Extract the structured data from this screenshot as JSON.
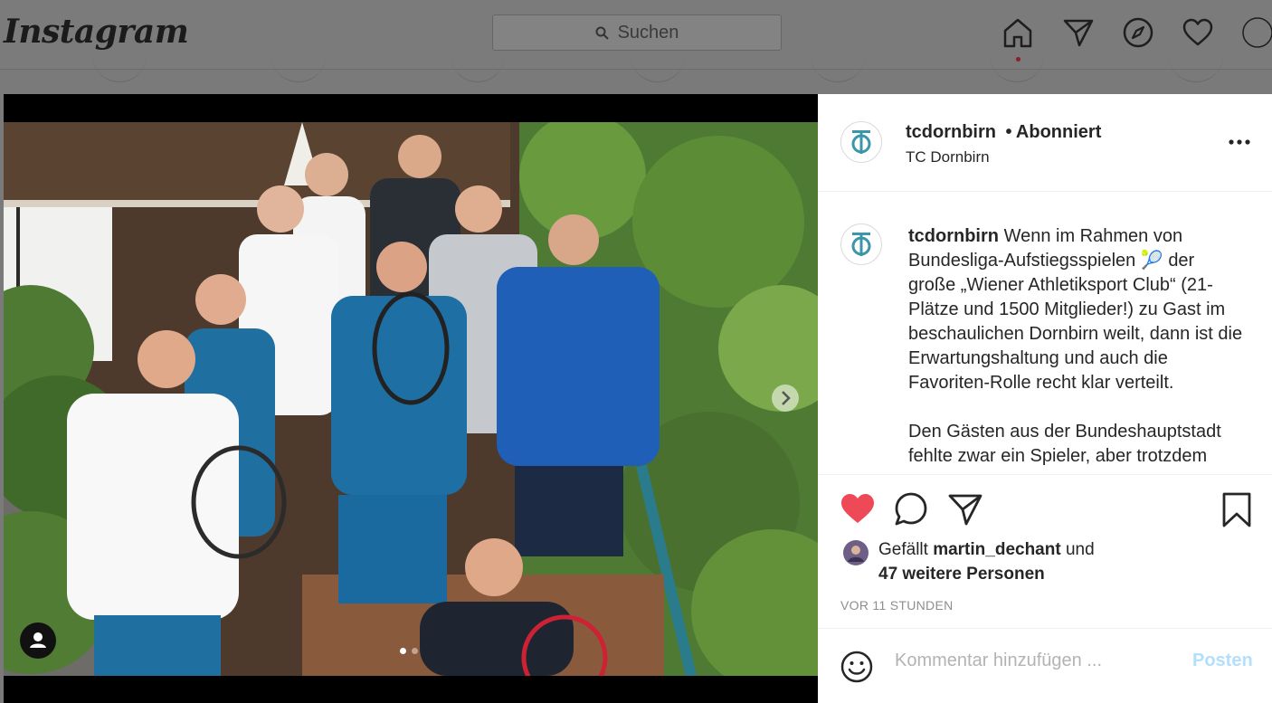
{
  "nav": {
    "logo": "Instagram",
    "search_placeholder": "Suchen"
  },
  "post": {
    "username": "tcdornbirn",
    "follow_status": "Abonniert",
    "separator": "•",
    "display_name": "TC Dornbirn",
    "more_label": "...",
    "caption_user": "tcdornbirn",
    "caption_p1_a": "Wenn im Rahmen von Bundesliga-Aufstiegsspielen",
    "caption_p1_emoji": "🎾",
    "caption_p1_b": "der große „Wiener Athletiksport Club“ (21-Plätze und 1500 Mitglieder!) zu Gast im beschaulichen Dornbirn weilt, dann ist die Erwartungshaltung und auch die Favoriten-Rolle recht klar verteilt.",
    "caption_p2": "Den Gästen aus der Bundeshauptstadt fehlte zwar ein Spieler, aber trotzdem",
    "likes_prefix": "Gefällt",
    "likes_user": "martin_dechant",
    "likes_and": "und",
    "likes_others": "47 weitere Personen",
    "time": "VOR 11 STUNDEN",
    "comment_placeholder": "Kommentar hinzufügen ...",
    "post_button": "Posten",
    "liked": true,
    "carousel_index": 1,
    "carousel_total": 2
  },
  "colors": {
    "like_red": "#ed4956",
    "post_disabled_blue": "#b2dffc",
    "club_teal": "#3a97a8"
  },
  "icons": [
    "home-icon",
    "direct-icon",
    "explore-icon",
    "heart-icon",
    "profile-icon",
    "search-icon",
    "more-icon",
    "like-icon",
    "comment-icon",
    "share-icon",
    "bookmark-icon",
    "emoji-icon",
    "tag-user-icon",
    "next-arrow-icon"
  ]
}
